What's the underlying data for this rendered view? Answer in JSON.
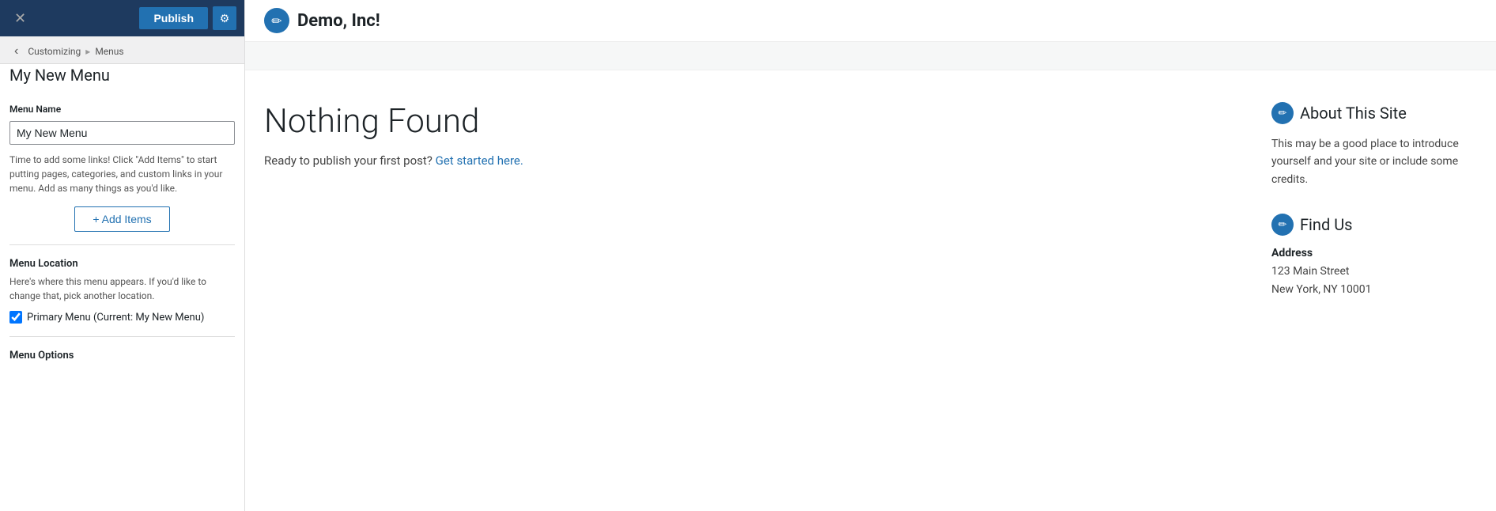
{
  "topbar": {
    "close_icon": "✕",
    "publish_label": "Publish",
    "gear_icon": "⚙"
  },
  "breadcrumb": {
    "back_icon": "‹",
    "parent": "Customizing",
    "separator": "▸",
    "section": "Menus",
    "title": "My New Menu"
  },
  "menu_name_section": {
    "label": "Menu Name",
    "input_value": "My New Menu",
    "hint": "Time to add some links! Click \"Add Items\" to start putting pages, categories, and custom links in your menu. Add as many things as you'd like.",
    "add_items_label": "+ Add Items"
  },
  "menu_location_section": {
    "title": "Menu Location",
    "hint": "Here's where this menu appears. If you'd like to change that, pick another location.",
    "primary_checkbox_label": "Primary Menu (Current: My New Menu)"
  },
  "menu_options_section": {
    "title": "Menu Options"
  },
  "preview": {
    "site_title": "Demo, Inc!",
    "pencil_icon": "✏",
    "nothing_found_heading": "Nothing Found",
    "nothing_found_sub": "Ready to publish your first post?",
    "get_started_link": "Get started here.",
    "widget_about_title": "About This Site",
    "widget_about_body": "This may be a good place to introduce yourself and your site or include some credits.",
    "widget_find_us_title": "Find Us",
    "address_label": "Address",
    "address_line1": "123 Main Street",
    "address_line2": "New York, NY 10001"
  }
}
